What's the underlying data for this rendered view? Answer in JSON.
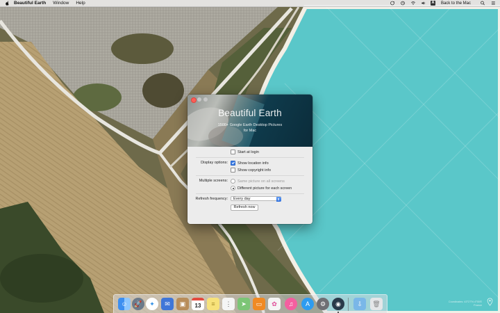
{
  "menubar": {
    "app_name": "Beautiful Earth",
    "menus": [
      "Window",
      "Help"
    ],
    "status_text": "Back to the Mac",
    "input_badge": "A",
    "icons": [
      "apple-icon",
      "sync-icon",
      "wifi-icon",
      "volume-icon",
      "keyboard-input-icon"
    ]
  },
  "window": {
    "hero_title": "Beautiful Earth",
    "hero_subtitle_line1": "1500+ Google Earth Desktop Pictures",
    "hero_subtitle_line2": "for Mac",
    "start_at_login_label": "Start at login",
    "start_at_login_checked": false,
    "display_options_label": "Display options:",
    "show_location_label": "Show location info",
    "show_location_checked": true,
    "show_copyright_label": "Show copyright info",
    "show_copyright_checked": false,
    "multiple_screens_label": "Multiple screens:",
    "same_picture_label": "Same picture on all screens",
    "different_picture_label": "Different picture for each screen",
    "selected_screen_option": "different",
    "refresh_frequency_label": "Refresh frequency:",
    "refresh_frequency_value": "Every day",
    "refresh_button_label": "Refresh now"
  },
  "dock": {
    "items": [
      {
        "name": "finder",
        "color": "#3d8ff0"
      },
      {
        "name": "launchpad",
        "color": "#6c7a8a"
      },
      {
        "name": "safari",
        "color": "#2f8fe6"
      },
      {
        "name": "mail",
        "color": "#3f76d8"
      },
      {
        "name": "contacts",
        "color": "#b88d5a"
      },
      {
        "name": "calendar",
        "color": "#ffffff",
        "text": "13"
      },
      {
        "name": "notes",
        "color": "#f7e27a"
      },
      {
        "name": "reminders",
        "color": "#f5f5f5"
      },
      {
        "name": "maps",
        "color": "#7cc576"
      },
      {
        "name": "ibooks",
        "color": "#f08a24"
      },
      {
        "name": "photos",
        "color": "#f5f5f5"
      },
      {
        "name": "itunes",
        "color": "#f45fa0"
      },
      {
        "name": "app-store",
        "color": "#2e9cf0"
      },
      {
        "name": "system-preferences",
        "color": "#6f6f74"
      },
      {
        "name": "beautiful-earth",
        "color": "#2a3b4a"
      },
      {
        "name": "downloads",
        "color": "#7ab7e8"
      },
      {
        "name": "trash",
        "color": "#e4e6e8"
      }
    ]
  },
  "attribution": {
    "line1": "Coordinates: 43°27′N 4°55′E",
    "line2": "France"
  }
}
